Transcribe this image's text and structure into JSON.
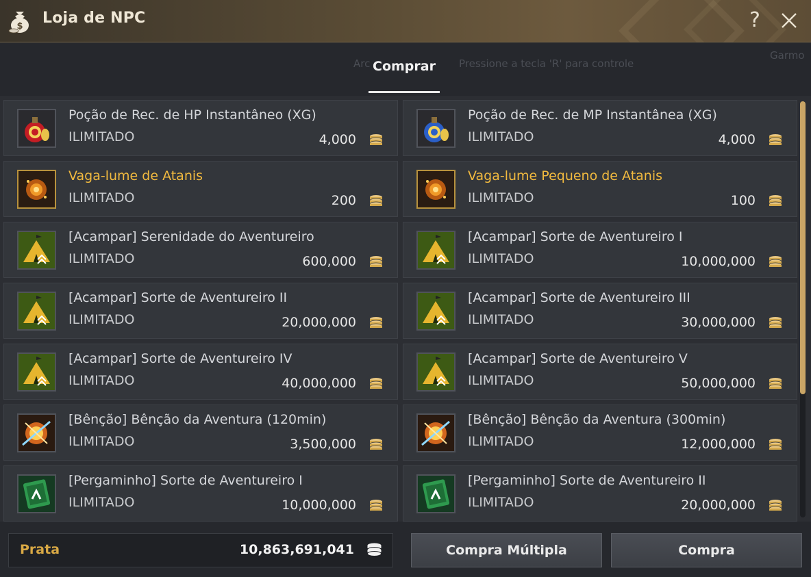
{
  "window": {
    "title": "Loja de NPC",
    "help_label": "?",
    "title_icon": "money-bag-icon",
    "close_icon": "close-icon"
  },
  "tabs": {
    "active": "Comprar",
    "background_hint_left": "Arc",
    "background_hint_right": "Pressione a tecla 'R' para controle",
    "background_hint_far": "Garmo"
  },
  "items": [
    {
      "name": "Poção de Rec. de HP Instantâneo (XG)",
      "limit": "ILIMITADO",
      "price": "4,000",
      "icon": "hp-potion-icon",
      "highlight": false
    },
    {
      "name": "Poção de Rec. de MP Instantânea (XG)",
      "limit": "ILIMITADO",
      "price": "4,000",
      "icon": "mp-potion-icon",
      "highlight": false
    },
    {
      "name": "Vaga-lume de Atanis",
      "limit": "ILIMITADO",
      "price": "200",
      "icon": "firefly-icon",
      "highlight": true
    },
    {
      "name": "Vaga-lume Pequeno de Atanis",
      "limit": "ILIMITADO",
      "price": "100",
      "icon": "firefly-icon",
      "highlight": true
    },
    {
      "name": "[Acampar] Serenidade do Aventureiro",
      "limit": "ILIMITADO",
      "price": "600,000",
      "icon": "camp-tent-icon",
      "highlight": false
    },
    {
      "name": "[Acampar] Sorte de Aventureiro I",
      "limit": "ILIMITADO",
      "price": "10,000,000",
      "icon": "camp-tent-icon",
      "highlight": false
    },
    {
      "name": "[Acampar] Sorte de Aventureiro II",
      "limit": "ILIMITADO",
      "price": "20,000,000",
      "icon": "camp-tent-icon",
      "highlight": false
    },
    {
      "name": "[Acampar] Sorte de Aventureiro III",
      "limit": "ILIMITADO",
      "price": "30,000,000",
      "icon": "camp-tent-icon",
      "highlight": false
    },
    {
      "name": "[Acampar] Sorte de Aventureiro IV",
      "limit": "ILIMITADO",
      "price": "40,000,000",
      "icon": "camp-tent-icon",
      "highlight": false
    },
    {
      "name": "[Acampar] Sorte de Aventureiro V",
      "limit": "ILIMITADO",
      "price": "50,000,000",
      "icon": "camp-tent-icon",
      "highlight": false
    },
    {
      "name": "[Bênção] Bênção da Aventura (120min)",
      "limit": "ILIMITADO",
      "price": "3,500,000",
      "icon": "blessing-icon",
      "highlight": false
    },
    {
      "name": "[Bênção] Bênção da Aventura (300min)",
      "limit": "ILIMITADO",
      "price": "12,000,000",
      "icon": "blessing-icon",
      "highlight": false
    },
    {
      "name": "[Pergaminho] Sorte de Aventureiro I",
      "limit": "ILIMITADO",
      "price": "10,000,000",
      "icon": "scroll-icon",
      "highlight": false
    },
    {
      "name": "[Pergaminho] Sorte de Aventureiro II",
      "limit": "ILIMITADO",
      "price": "20,000,000",
      "icon": "scroll-icon",
      "highlight": false
    }
  ],
  "footer": {
    "currency_label": "Prata",
    "currency_amount": "10,863,691,041",
    "currency_icon": "silver-coins-icon",
    "multi_buy_label": "Compra Múltipla",
    "buy_label": "Compra"
  },
  "colors": {
    "highlight_name": "#f2ba3f",
    "currency_label": "#d9a945",
    "scroll_thumb": "#c9a566"
  }
}
